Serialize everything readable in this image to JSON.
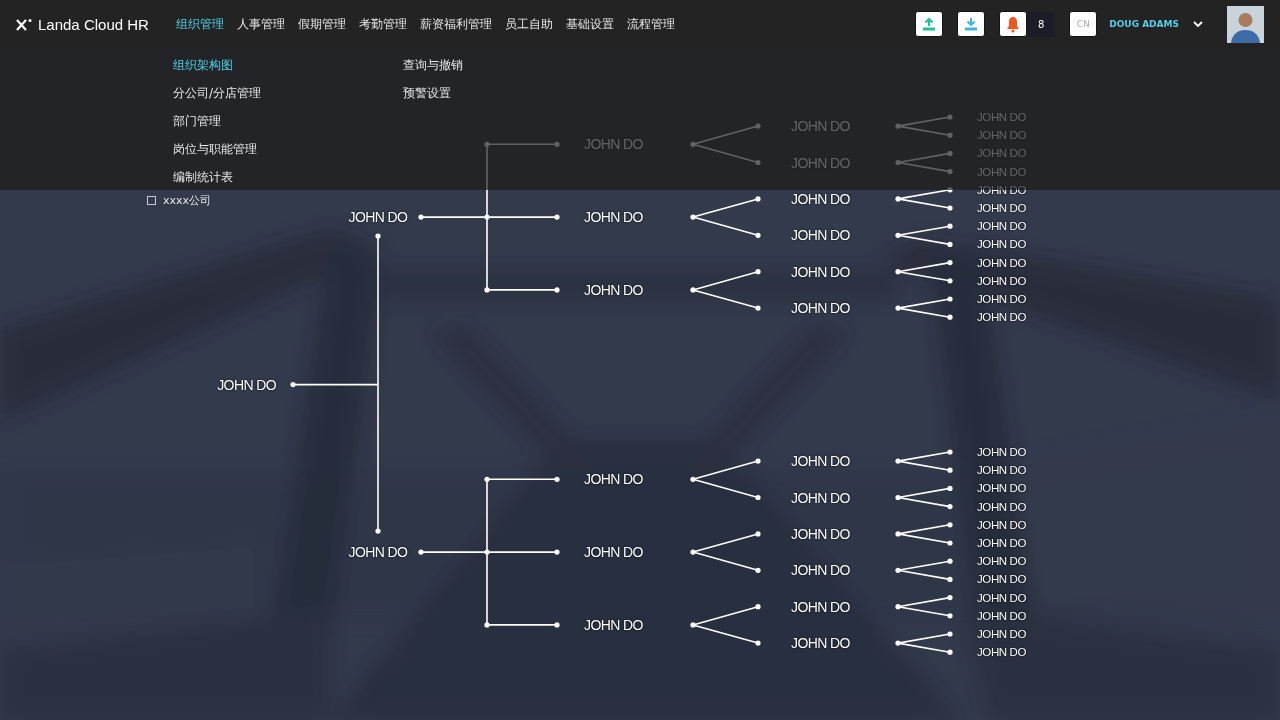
{
  "header": {
    "logo": "Landa Cloud HR",
    "nav": [
      {
        "label": "组织管理",
        "selected": true
      },
      {
        "label": "人事管理",
        "selected": false
      },
      {
        "label": "假期管理",
        "selected": false
      },
      {
        "label": "考勤管理",
        "selected": false
      },
      {
        "label": "薪资福利管理",
        "selected": false
      },
      {
        "label": "员工自助",
        "selected": false
      },
      {
        "label": "基础设置",
        "selected": false
      },
      {
        "label": "流程管理",
        "selected": false
      }
    ],
    "notifications": {
      "count": "8"
    },
    "language": "CN",
    "user": {
      "name": "DOUG ADAMS"
    }
  },
  "menu": {
    "columns": [
      [
        {
          "label": "组织架构图",
          "selected": true
        },
        {
          "label": "分公司/分店管理",
          "selected": false
        },
        {
          "label": "部门管理",
          "selected": false
        },
        {
          "label": "岗位与职能管理",
          "selected": false
        },
        {
          "label": "编制统计表",
          "selected": false
        }
      ],
      [
        {
          "label": "查询与撤销",
          "selected": false
        },
        {
          "label": "预警设置",
          "selected": false
        }
      ]
    ]
  },
  "page": {
    "filters": [
      {
        "label": "xxxx公司",
        "checked": false
      }
    ]
  },
  "org_chart": {
    "name": "JOHN DO",
    "children": [
      {
        "name": "JOHN DO",
        "children": [
          {
            "name": "JOHN DO",
            "children": [
              {
                "name": "JOHN DO",
                "children": [
                  {
                    "name": "JOHN DO"
                  },
                  {
                    "name": "JOHN DO"
                  }
                ]
              },
              {
                "name": "JOHN DO",
                "children": [
                  {
                    "name": "JOHN DO"
                  },
                  {
                    "name": "JOHN DO"
                  }
                ]
              }
            ]
          },
          {
            "name": "JOHN DO",
            "children": [
              {
                "name": "JOHN DO",
                "children": [
                  {
                    "name": "JOHN DO"
                  },
                  {
                    "name": "JOHN DO"
                  }
                ]
              },
              {
                "name": "JOHN DO",
                "children": [
                  {
                    "name": "JOHN DO"
                  },
                  {
                    "name": "JOHN DO"
                  }
                ]
              }
            ]
          },
          {
            "name": "JOHN DO",
            "children": [
              {
                "name": "JOHN DO",
                "children": [
                  {
                    "name": "JOHN DO"
                  },
                  {
                    "name": "JOHN DO"
                  }
                ]
              },
              {
                "name": "JOHN DO",
                "children": [
                  {
                    "name": "JOHN DO"
                  },
                  {
                    "name": "JOHN DO"
                  }
                ]
              }
            ]
          }
        ]
      },
      {
        "name": "JOHN DO",
        "children": [
          {
            "name": "JOHN DO",
            "children": [
              {
                "name": "JOHN DO",
                "children": [
                  {
                    "name": "JOHN DO"
                  },
                  {
                    "name": "JOHN DO"
                  }
                ]
              },
              {
                "name": "JOHN DO",
                "children": [
                  {
                    "name": "JOHN DO"
                  },
                  {
                    "name": "JOHN DO"
                  }
                ]
              }
            ]
          },
          {
            "name": "JOHN DO",
            "children": [
              {
                "name": "JOHN DO",
                "children": [
                  {
                    "name": "JOHN DO"
                  },
                  {
                    "name": "JOHN DO"
                  }
                ]
              },
              {
                "name": "JOHN DO",
                "children": [
                  {
                    "name": "JOHN DO"
                  },
                  {
                    "name": "JOHN DO"
                  }
                ]
              }
            ]
          },
          {
            "name": "JOHN DO",
            "children": [
              {
                "name": "JOHN DO",
                "children": [
                  {
                    "name": "JOHN DO"
                  },
                  {
                    "name": "JOHN DO"
                  }
                ]
              },
              {
                "name": "JOHN DO",
                "children": [
                  {
                    "name": "JOHN DO"
                  },
                  {
                    "name": "JOHN DO"
                  }
                ]
              }
            ]
          }
        ]
      }
    ]
  }
}
